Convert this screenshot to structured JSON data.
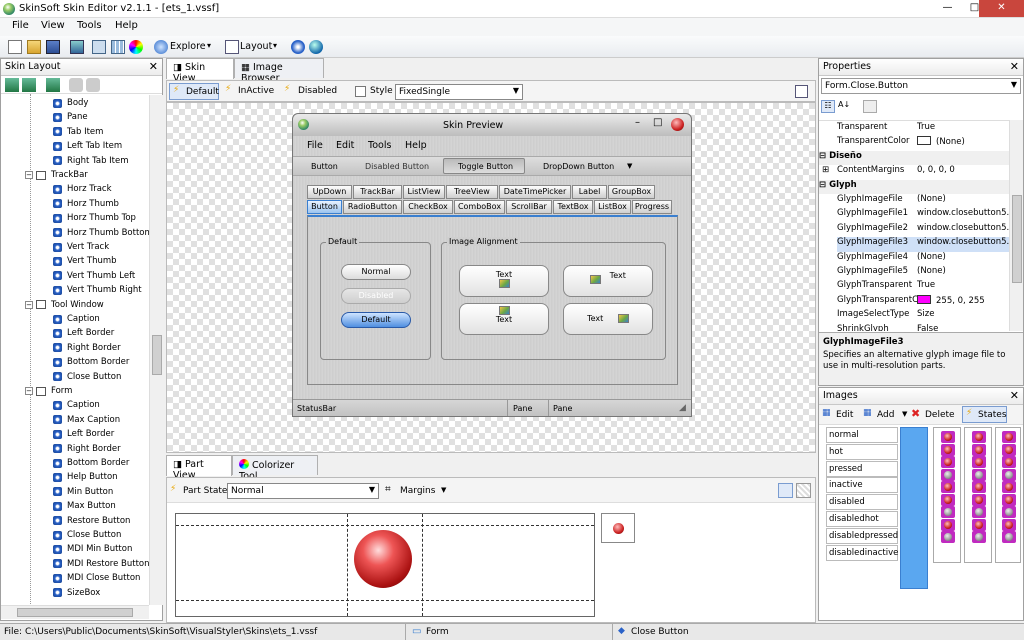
{
  "window": {
    "title": "SkinSoft Skin Editor v2.1.1 - [ets_1.vssf]",
    "minimize": "—",
    "maximize": "□",
    "close": "✕"
  },
  "menu": [
    "File",
    "View",
    "Tools",
    "Help"
  ],
  "toolbar": {
    "explore": "Explore",
    "layout": "Layout"
  },
  "skin_layout": {
    "title": "Skin Layout",
    "items": [
      {
        "label": "Body",
        "kind": "leaf"
      },
      {
        "label": "Pane",
        "kind": "leaf"
      },
      {
        "label": "Tab Item",
        "kind": "leaf"
      },
      {
        "label": "Left Tab Item",
        "kind": "leaf"
      },
      {
        "label": "Right Tab Item",
        "kind": "leaf"
      },
      {
        "label": "TrackBar",
        "kind": "group"
      },
      {
        "label": "Horz Track",
        "kind": "leaf"
      },
      {
        "label": "Horz Thumb",
        "kind": "leaf"
      },
      {
        "label": "Horz Thumb Top",
        "kind": "leaf"
      },
      {
        "label": "Horz Thumb Bottom",
        "kind": "leaf"
      },
      {
        "label": "Vert Track",
        "kind": "leaf"
      },
      {
        "label": "Vert Thumb",
        "kind": "leaf"
      },
      {
        "label": "Vert Thumb Left",
        "kind": "leaf"
      },
      {
        "label": "Vert Thumb Right",
        "kind": "leaf"
      },
      {
        "label": "Tool Window",
        "kind": "group"
      },
      {
        "label": "Caption",
        "kind": "leaf"
      },
      {
        "label": "Left Border",
        "kind": "leaf"
      },
      {
        "label": "Right Border",
        "kind": "leaf"
      },
      {
        "label": "Bottom Border",
        "kind": "leaf"
      },
      {
        "label": "Close Button",
        "kind": "leaf"
      },
      {
        "label": "Form",
        "kind": "group"
      },
      {
        "label": "Caption",
        "kind": "leaf"
      },
      {
        "label": "Max Caption",
        "kind": "leaf"
      },
      {
        "label": "Left Border",
        "kind": "leaf"
      },
      {
        "label": "Right Border",
        "kind": "leaf"
      },
      {
        "label": "Bottom Border",
        "kind": "leaf"
      },
      {
        "label": "Help Button",
        "kind": "leaf"
      },
      {
        "label": "Min Button",
        "kind": "leaf"
      },
      {
        "label": "Max Button",
        "kind": "leaf"
      },
      {
        "label": "Restore Button",
        "kind": "leaf"
      },
      {
        "label": "Close Button",
        "kind": "leaf"
      },
      {
        "label": "MDI Min Button",
        "kind": "leaf"
      },
      {
        "label": "MDI Restore Button",
        "kind": "leaf"
      },
      {
        "label": "MDI Close Button",
        "kind": "leaf"
      },
      {
        "label": "SizeBox",
        "kind": "leaf"
      }
    ]
  },
  "doc_tabs": {
    "skin_view": "Skin View",
    "image_browser": "Image Browser"
  },
  "state_bar": {
    "default": "Default",
    "inactive": "InActive",
    "disabled": "Disabled",
    "style": "Style",
    "style_value": "FixedSingle"
  },
  "preview": {
    "title": "Skin Preview",
    "menu": [
      "File",
      "Edit",
      "Tools",
      "Help"
    ],
    "buttons": [
      "Button",
      "Disabled Button",
      "Toggle Button",
      "DropDown Button"
    ],
    "tabs_row1": [
      "UpDown",
      "TrackBar",
      "ListView",
      "TreeView",
      "DateTimePicker",
      "Label",
      "GroupBox"
    ],
    "tabs_row2": [
      "Button",
      "RadioButton",
      "CheckBox",
      "ComboBox",
      "ScrollBar",
      "TextBox",
      "ListBox",
      "Progress"
    ],
    "group_default": "Default",
    "btn_normal": "Normal",
    "btn_disabled": "Disabled",
    "btn_default": "Default",
    "group_alignment": "Image Alignment",
    "text": "Text",
    "status": "StatusBar",
    "pane1": "Pane",
    "pane2": "Pane"
  },
  "part_tabs": {
    "part_view": "Part View",
    "colorizer": "Colorizer Tool"
  },
  "part_bar": {
    "label": "Part State",
    "value": "Normal",
    "margins": "Margins"
  },
  "properties": {
    "title": "Properties",
    "object": "Form.Close.Button",
    "rows": [
      {
        "k": "Transparent",
        "v": "True",
        "type": "prop"
      },
      {
        "k": "TransparentColor",
        "v": "(None)",
        "type": "prop",
        "swatch": "#ffffff"
      },
      {
        "k": "Diseño",
        "v": "",
        "type": "cat"
      },
      {
        "k": "ContentMargins",
        "v": "0, 0, 0, 0",
        "type": "prop"
      },
      {
        "k": "Glyph",
        "v": "",
        "type": "cat"
      },
      {
        "k": "GlyphImageFile",
        "v": "(None)",
        "type": "prop"
      },
      {
        "k": "GlyphImageFile1",
        "v": "window.closebutton5.",
        "type": "prop"
      },
      {
        "k": "GlyphImageFile2",
        "v": "window.closebutton5.",
        "type": "prop"
      },
      {
        "k": "GlyphImageFile3",
        "v": "window.closebutton5.",
        "type": "prop"
      },
      {
        "k": "GlyphImageFile4",
        "v": "(None)",
        "type": "prop"
      },
      {
        "k": "GlyphImageFile5",
        "v": "(None)",
        "type": "prop"
      },
      {
        "k": "GlyphTransparent",
        "v": "True",
        "type": "prop"
      },
      {
        "k": "GlyphTransparentC",
        "v": "255, 0, 255",
        "type": "prop",
        "swatch": "#ff00ff"
      },
      {
        "k": "ImageSelectType",
        "v": "Size",
        "type": "prop"
      },
      {
        "k": "ShrinkGlyph",
        "v": "False",
        "type": "prop"
      }
    ],
    "desc_title": "GlyphImageFile3",
    "desc_text": "Specifies an alternative glyph image file to use in multi-resolution parts."
  },
  "images": {
    "title": "Images",
    "edit": "Edit",
    "add": "Add",
    "delete": "Delete",
    "states": "States",
    "list": [
      "normal",
      "hot",
      "pressed",
      "inactive",
      "disabled",
      "disabledhot",
      "disabledpressed",
      "disabledinactive"
    ]
  },
  "status": {
    "path": "File: C:\\Users\\Public\\Documents\\SkinSoft\\VisualStyler\\Skins\\ets_1.vssf",
    "form": "Form",
    "part": "Close Button"
  },
  "colors": {
    "accent": "#3a7fd0",
    "magenta": "#c02ac0",
    "close_red": "#c9463d"
  }
}
